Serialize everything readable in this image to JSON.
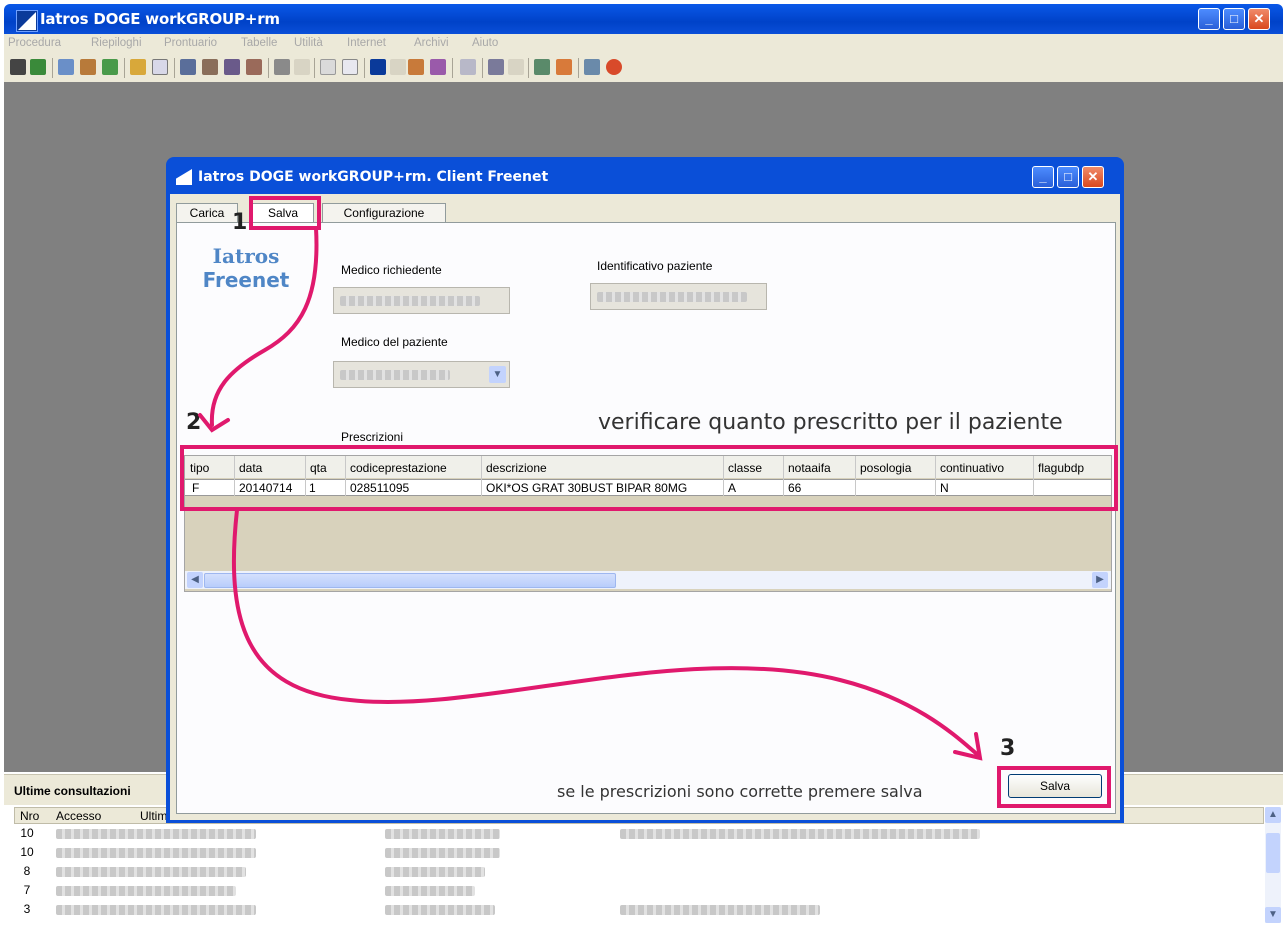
{
  "main_window": {
    "title": "Iatros DOGE workGROUP+rm",
    "menu": [
      "Procedura",
      "Riepiloghi",
      "Prontuario",
      "Tabelle",
      "Utilità",
      "Internet",
      "Archivi",
      "Aiuto"
    ]
  },
  "dialog": {
    "title": "Iatros DOGE workGROUP+rm. Client Freenet",
    "tabs": [
      "Carica",
      "Salva",
      "Configurazione"
    ],
    "active_tab": "Salva",
    "logo_line1": "Iatros",
    "logo_line2": "Freenet",
    "medico_richiedente_label": "Medico richiedente",
    "identificativo_paziente_label": "Identificativo paziente",
    "medico_paziente_label": "Medico del paziente",
    "prescrizioni_label": "Prescrizioni",
    "grid": {
      "columns": [
        "tipo",
        "data",
        "qta",
        "codiceprestazione",
        "descrizione",
        "classe",
        "notaaifa",
        "posologia",
        "continuativo",
        "flagubdp"
      ],
      "rows": [
        [
          "F",
          "20140714",
          "1",
          "028511095",
          "OKI*OS GRAT 30BUST BIPAR 80MG",
          "A",
          "66",
          "",
          "N",
          ""
        ]
      ]
    },
    "save_button": "Salva"
  },
  "bottom_panel": {
    "title": "Ultime consultazioni",
    "columns": [
      "Nro",
      "Accesso",
      "Ultim"
    ],
    "row_numbers": [
      "10",
      "10",
      "8",
      "7",
      "3"
    ]
  },
  "annotations": {
    "step1": "1",
    "step2": "2",
    "step3": "3",
    "verify_text": "verificare quanto prescritto per il paziente",
    "save_text": "se le prescrizioni sono corrette premere salva"
  },
  "colors": {
    "xp_blue": "#0a4fd8",
    "highlight_pink": "#e0196d",
    "logo_blue": "#4f86c6"
  }
}
